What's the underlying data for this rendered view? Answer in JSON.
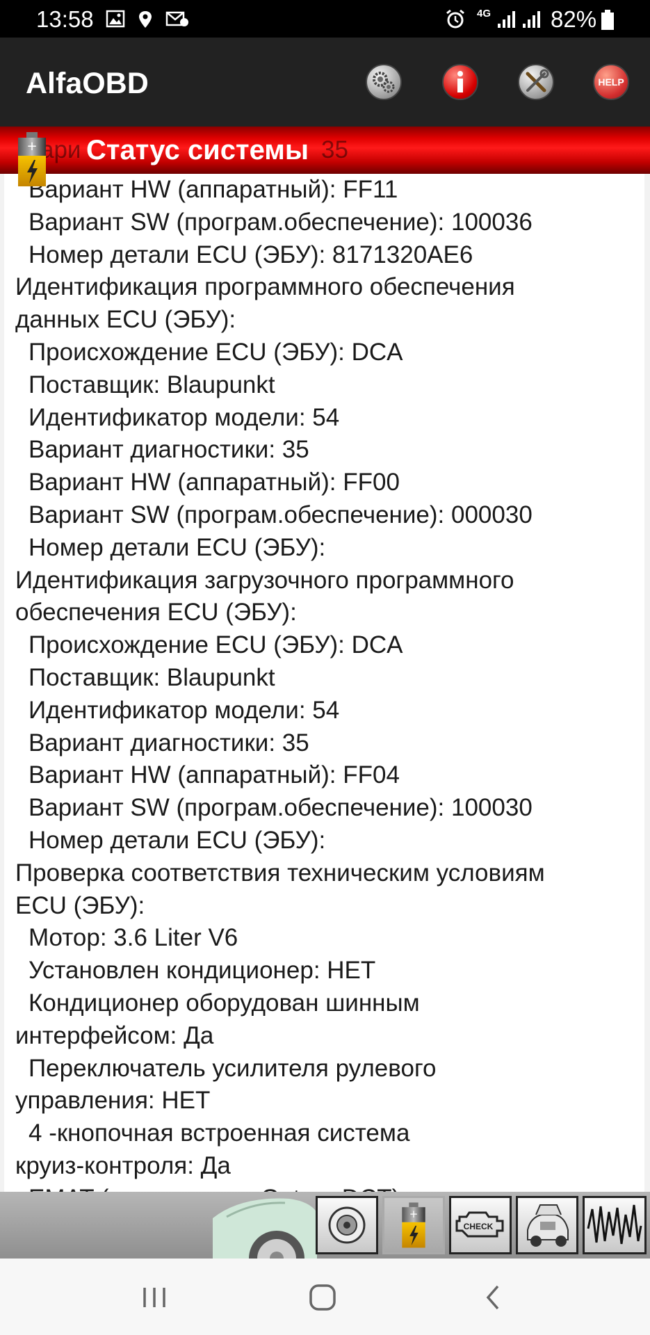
{
  "status_bar": {
    "time": "13:58",
    "network": "4G",
    "battery_pct": "82%"
  },
  "app": {
    "title": "AlfaOBD",
    "buttons": {
      "help_label": "HELP"
    }
  },
  "header": {
    "title": "Статус системы",
    "overlapped_line_start": "ари",
    "overlapped_line_end": "35"
  },
  "content": {
    "lines": [
      {
        "text": "Вариант HW (аппаратный): FF11",
        "indent": true
      },
      {
        "text": "Вариант SW (програм.обеспечение): 100036",
        "indent": true
      },
      {
        "text": "Номер детали ECU (ЭБУ): 8171320AE6",
        "indent": true
      },
      {
        "text": "Идентификация программного обеспечения",
        "indent": false
      },
      {
        "text": "данных ECU (ЭБУ):",
        "indent": false
      },
      {
        "text": "Происхождение ECU (ЭБУ): DCA",
        "indent": true
      },
      {
        "text": "Поставщик: Blaupunkt",
        "indent": true
      },
      {
        "text": "Идентификатор модели: 54",
        "indent": true
      },
      {
        "text": "Вариант диагностики: 35",
        "indent": true
      },
      {
        "text": "Вариант HW (аппаратный): FF00",
        "indent": true
      },
      {
        "text": "Вариант SW (програм.обеспечение): 000030",
        "indent": true
      },
      {
        "text": "Номер детали ECU (ЭБУ):",
        "indent": true
      },
      {
        "text": "Идентификация загрузочного программного",
        "indent": false
      },
      {
        "text": "обеспечения ECU (ЭБУ):",
        "indent": false
      },
      {
        "text": "Происхождение ECU (ЭБУ): DCA",
        "indent": true
      },
      {
        "text": "Поставщик: Blaupunkt",
        "indent": true
      },
      {
        "text": "Идентификатор модели: 54",
        "indent": true
      },
      {
        "text": "Вариант диагностики: 35",
        "indent": true
      },
      {
        "text": "Вариант HW (аппаратный): FF04",
        "indent": true
      },
      {
        "text": "Вариант SW (програм.обеспечение): 100030",
        "indent": true
      },
      {
        "text": "Номер детали ECU (ЭБУ):",
        "indent": true
      },
      {
        "text": "Проверка соответствия техническим условиям",
        "indent": false
      },
      {
        "text": "ECU (ЭБУ):",
        "indent": false
      },
      {
        "text": "Мотор: 3.6 Liter V6",
        "indent": true
      },
      {
        "text": "Установлен кондиционер: НЕТ",
        "indent": true
      },
      {
        "text": "Кондиционер оборудован шинным",
        "indent": true
      },
      {
        "text": "интерфейсом: Да",
        "indent": false
      },
      {
        "text": "Переключатель усилителя рулевого",
        "indent": true
      },
      {
        "text": "управления: НЕТ",
        "indent": false
      },
      {
        "text": "4 -кнопочная встроенная система",
        "indent": true
      },
      {
        "text": "круиз-контроля: Да",
        "indent": false
      },
      {
        "text": "EMAT (трансмиссия Getrag DCT) установлен:",
        "indent": true
      }
    ]
  },
  "toolbar": {
    "check_label": "CHECK"
  },
  "icons": {
    "app_buttons": [
      "gears-icon",
      "info-icon",
      "tools-icon",
      "help-icon"
    ],
    "toolbar": [
      "speaker-icon",
      "battery-icon",
      "check-engine-icon",
      "car-hood-icon",
      "waveform-icon"
    ],
    "nav": [
      "recents-icon",
      "home-icon",
      "back-icon"
    ]
  },
  "colors": {
    "header_red": "#e00000",
    "appbar": "#222222",
    "statusbar": "#000000",
    "content_bg": "#ffffff"
  }
}
